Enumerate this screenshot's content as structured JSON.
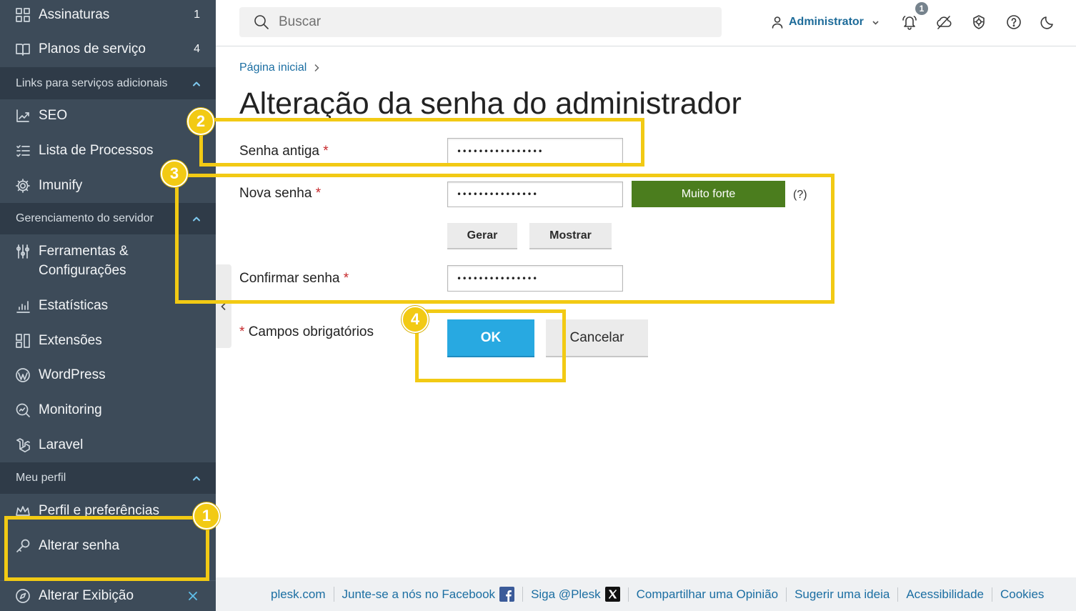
{
  "sidebar": {
    "top_items": [
      {
        "label": "Assinaturas",
        "count": "1",
        "icon": "grid-icon"
      },
      {
        "label": "Planos de serviço",
        "count": "4",
        "icon": "book-icon"
      }
    ],
    "sections": [
      {
        "title": "Links para serviços adicionais",
        "items": [
          {
            "label": "SEO",
            "icon": "seo-icon"
          },
          {
            "label": "Lista de Processos",
            "icon": "process-list-icon"
          },
          {
            "label": "Imunify",
            "icon": "imunify-gear-icon"
          }
        ]
      },
      {
        "title": "Gerenciamento do servidor",
        "items": [
          {
            "label": "Ferramentas & Configurações",
            "icon": "tools-settings-icon"
          },
          {
            "label": "Estatísticas",
            "icon": "statistics-icon"
          },
          {
            "label": "Extensões",
            "icon": "extensions-icon"
          },
          {
            "label": "WordPress",
            "icon": "wordpress-icon"
          },
          {
            "label": "Monitoring",
            "icon": "monitoring-icon"
          },
          {
            "label": "Laravel",
            "icon": "laravel-icon"
          }
        ]
      },
      {
        "title": "Meu perfil",
        "items": [
          {
            "label": "Perfil e preferências",
            "icon": "profile-crown-icon"
          },
          {
            "label": "Alterar senha",
            "icon": "key-icon"
          }
        ]
      }
    ],
    "change_view": {
      "label": "Alterar Exibição",
      "icon": "compass-icon"
    }
  },
  "header": {
    "search_placeholder": "Buscar",
    "user": "Administrator",
    "notifications_count": "1",
    "icons": [
      "notifications-icon",
      "cloud-off-icon",
      "imunify-shield-icon",
      "help-icon",
      "dark-mode-icon"
    ]
  },
  "breadcrumb": [
    "Página inicial"
  ],
  "page_title": "Alteração da senha do administrador",
  "form": {
    "required_marker": "*",
    "old_password": {
      "label": "Senha antiga",
      "value": "••••••••••••••••"
    },
    "new_password": {
      "label": "Nova senha",
      "value": "•••••••••••••••",
      "strength": "Muito forte",
      "help": "(?)"
    },
    "generate_label": "Gerar",
    "show_label": "Mostrar",
    "confirm_password": {
      "label": "Confirmar senha",
      "value": "•••••••••••••••"
    },
    "required_note": "Campos obrigatórios",
    "ok_label": "OK",
    "cancel_label": "Cancelar"
  },
  "annotations": [
    "1",
    "2",
    "3",
    "4"
  ],
  "footer": {
    "links": [
      "plesk.com",
      "Junte-se a nós no Facebook",
      "Siga @Plesk",
      "Compartilhar uma Opinião",
      "Sugerir uma ideia",
      "Acessibilidade",
      "Cookies"
    ]
  },
  "colors": {
    "sidebar": "#3d4b59",
    "sidebar_section": "#2f3b48",
    "accent": "#28a9e1",
    "link": "#1b6ea2",
    "strength_very_strong": "#4b7d1e",
    "annotation": "#f2ca14",
    "required": "#c6282b"
  }
}
